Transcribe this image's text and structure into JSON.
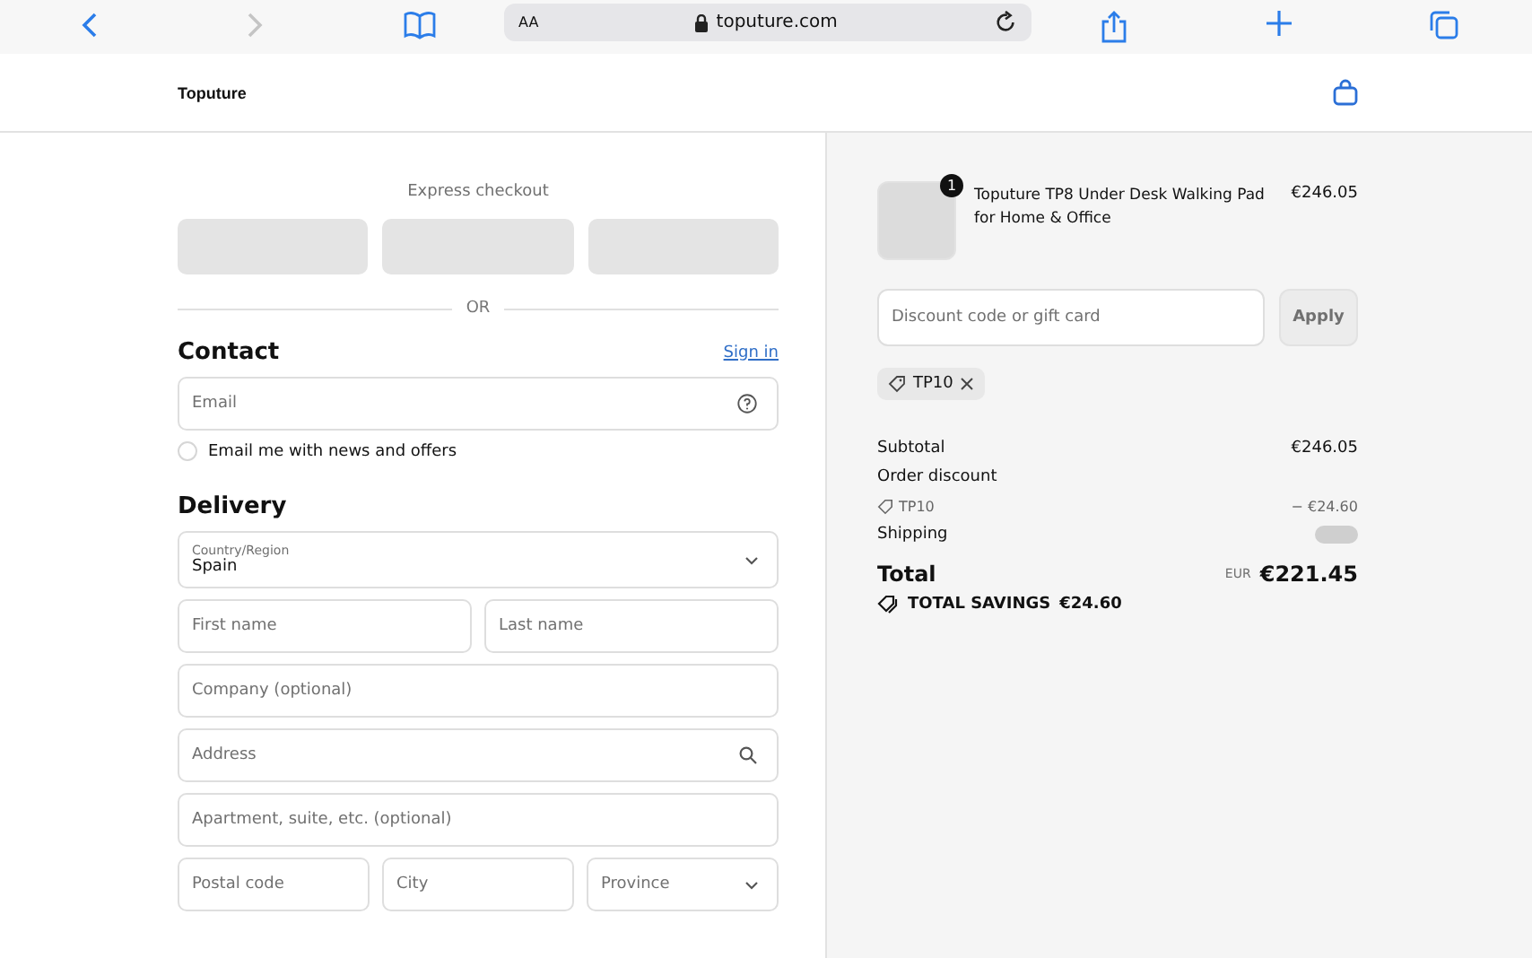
{
  "browser": {
    "text_size": "AA",
    "url": "toputure.com",
    "back_disabled": false,
    "forward_disabled": true
  },
  "header": {
    "logo": "Toputure"
  },
  "checkout": {
    "express_title": "Express checkout",
    "divider": "OR",
    "contact": {
      "title": "Contact",
      "sign_in": "Sign in",
      "email_placeholder": "Email",
      "newsletter": {
        "label": "Email me with news and offers",
        "checked": false
      }
    },
    "delivery": {
      "title": "Delivery",
      "country": {
        "label": "Country/Region",
        "value": "Spain"
      },
      "name_fields": [
        {
          "placeholder": "First name"
        },
        {
          "placeholder": "Last name"
        }
      ],
      "company_placeholder": "Company (optional)",
      "address_placeholder": "Address",
      "apartment_placeholder": "Apartment, suite, etc. (optional)",
      "last_row": [
        {
          "placeholder": "Postal code",
          "kind": "text"
        },
        {
          "placeholder": "City",
          "kind": "text"
        },
        {
          "placeholder": "Province",
          "kind": "select"
        }
      ]
    }
  },
  "summary": {
    "item": {
      "quantity": "1",
      "name": "Toputure TP8 Under Desk Walking Pad for Home & Office",
      "price": "€246.05"
    },
    "discount_placeholder": "Discount code or gift card",
    "apply": "Apply",
    "applied_code": "TP10",
    "subtotal_label": "Subtotal",
    "subtotal": "€246.05",
    "order_discount_label": "Order discount",
    "discount_code": "TP10",
    "discount_amount": "− €24.60",
    "shipping_label": "Shipping",
    "total_label": "Total",
    "currency": "EUR",
    "total": "€221.45",
    "savings_label": "TOTAL SAVINGS",
    "savings": "€24.60"
  }
}
